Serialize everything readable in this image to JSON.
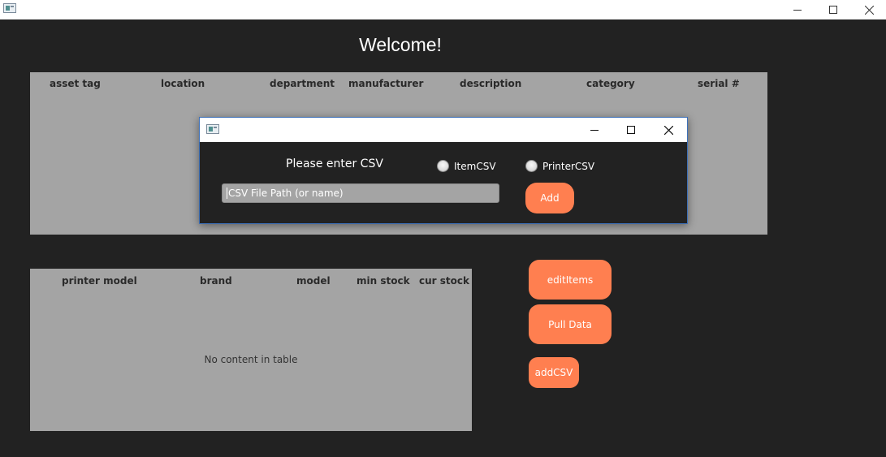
{
  "window": {
    "welcome": "Welcome!"
  },
  "items_table": {
    "columns": [
      "asset tag",
      "location",
      "department",
      "manufacturer",
      "description",
      "category",
      "serial #"
    ]
  },
  "printer_table": {
    "columns": [
      "printer model",
      "brand",
      "model",
      "min stock",
      "cur stock"
    ],
    "placeholder": "No content in table"
  },
  "actions": {
    "edit_items": "editItems",
    "pull_data": "Pull Data",
    "add_csv": "addCSV"
  },
  "dialog": {
    "prompt": "Please enter CSV",
    "radios": [
      {
        "label": "ItemCSV",
        "selected": false
      },
      {
        "label": "PrinterCSV",
        "selected": false
      }
    ],
    "input": {
      "value": "",
      "placeholder": "CSV File Path (or name)"
    },
    "add_label": "Add"
  },
  "colors": {
    "background": "#222222",
    "table": "#a4a4a4",
    "accent": "#ff7f50",
    "dialog_border": "#3c6fb7"
  }
}
